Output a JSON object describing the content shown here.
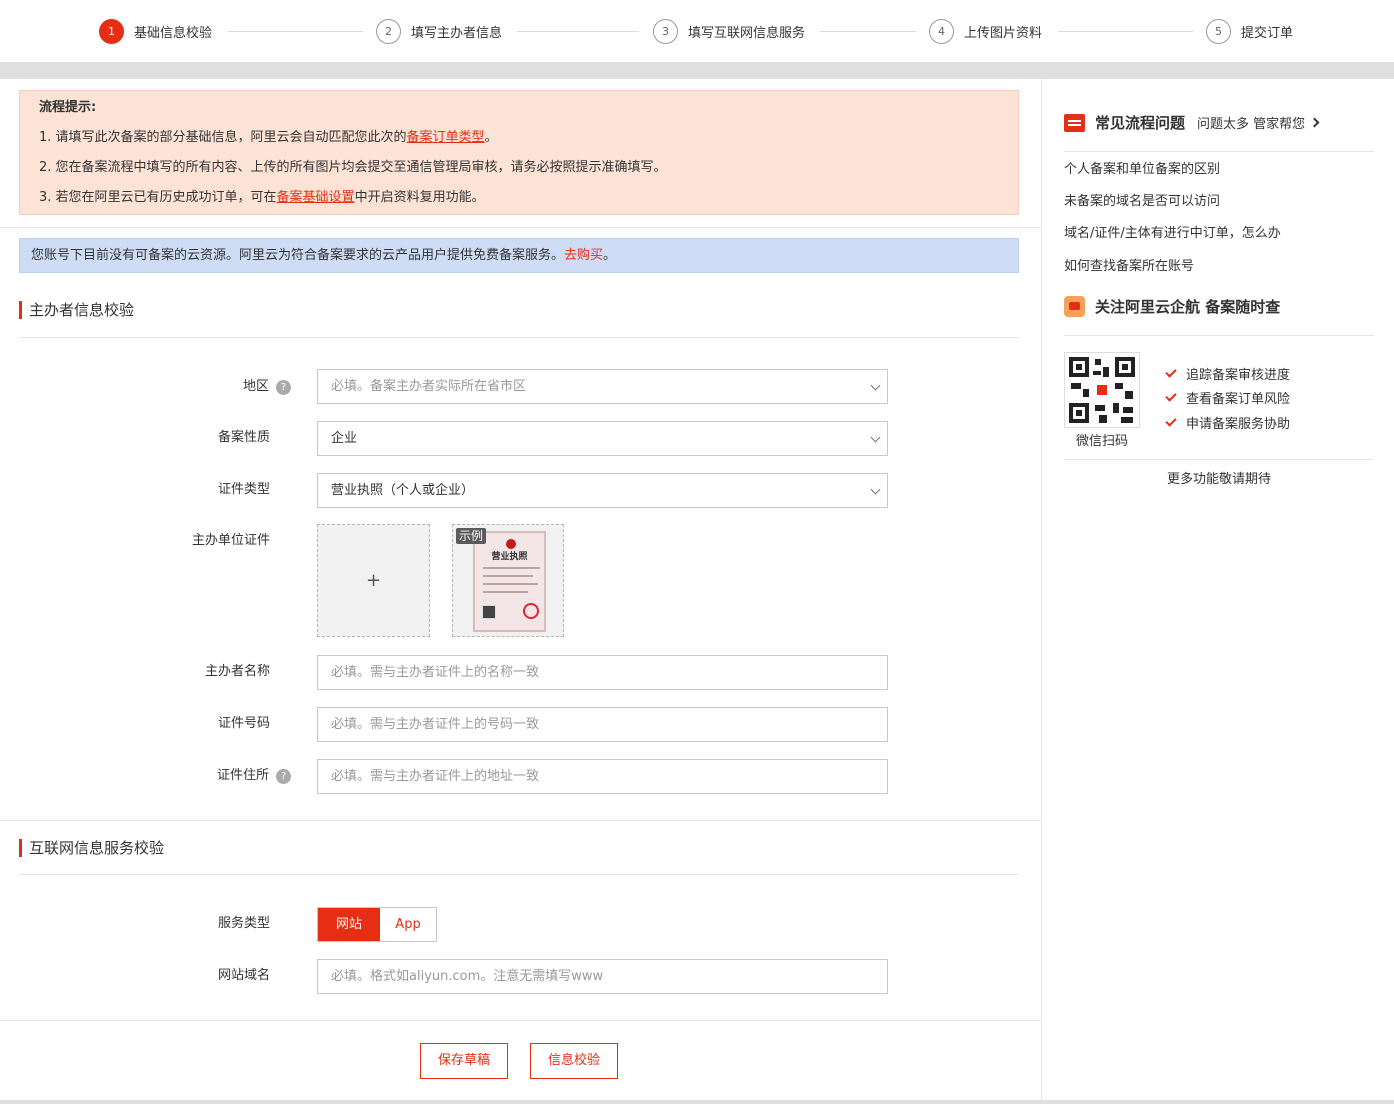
{
  "steps": [
    {
      "num": "1",
      "label": "基础信息校验"
    },
    {
      "num": "2",
      "label": "填写主办者信息"
    },
    {
      "num": "3",
      "label": "填写互联网信息服务"
    },
    {
      "num": "4",
      "label": "上传图片资料"
    },
    {
      "num": "5",
      "label": "提交订单"
    }
  ],
  "active_step": 1,
  "notice": {
    "title": "流程提示:",
    "line1_pre": "1. 请填写此次备案的部分基础信息，阿里云会自动匹配您此次的",
    "line1_link": "备案订单类型",
    "line1_post": "。",
    "line2": "2. 您在备案流程中填写的所有内容、上传的所有图片均会提交至通信管理局审核，请务必按照提示准确填写。",
    "line3_pre": "3. 若您在阿里云已有历史成功订单，可在",
    "line3_link": "备案基础设置",
    "line3_post": "中开启资料复用功能。"
  },
  "info_bar": {
    "text": "您账号下目前没有可备案的云资源。阿里云为符合备案要求的云产品用户提供免费备案服务。",
    "link": "去购买",
    "post": "。"
  },
  "section1": {
    "title": "主办者信息校验",
    "region": {
      "label": "地区",
      "help": "?",
      "placeholder": "必填。备案主办者实际所在省市区"
    },
    "nature": {
      "label": "备案性质",
      "value": "企业"
    },
    "cert_type": {
      "label": "证件类型",
      "value": "营业执照（个人或企业）"
    },
    "cert_upload": {
      "label": "主办单位证件",
      "plus": "+",
      "sample_tag": "示例",
      "sample_title": "营业执照"
    },
    "name": {
      "label": "主办者名称",
      "placeholder": "必填。需与主办者证件上的名称一致"
    },
    "cert_no": {
      "label": "证件号码",
      "placeholder": "必填。需与主办者证件上的号码一致"
    },
    "cert_addr": {
      "label": "证件住所",
      "help": "?",
      "placeholder": "必填。需与主办者证件上的地址一致"
    }
  },
  "section2": {
    "title": "互联网信息服务校验",
    "service_type": {
      "label": "服务类型",
      "options": [
        "网站",
        "App"
      ],
      "selected": "网站"
    },
    "domain": {
      "label": "网站域名",
      "placeholder": "必填。格式如aliyun.com。注意无需填写www"
    }
  },
  "buttons": {
    "save": "保存草稿",
    "verify": "信息校验"
  },
  "sidebar": {
    "faq_title": "常见流程问题",
    "faq_sub": "问题太多 管家帮您",
    "faq_items": [
      "个人备案和单位备案的区别",
      "未备案的域名是否可以访问",
      "域名/证件/主体有进行中订单，怎么办",
      "如何查找备案所在账号"
    ],
    "follow_title": "关注阿里云企航 备案随时查",
    "qr_label": "微信扫码",
    "features": [
      "追踪备案审核进度",
      "查看备案订单风险",
      "申请备案服务协助"
    ],
    "more": "更多功能敬请期待"
  },
  "colors": {
    "accent": "#e62e14",
    "notice_bg": "#fde2d6",
    "info_bg": "#cfdcf5"
  }
}
